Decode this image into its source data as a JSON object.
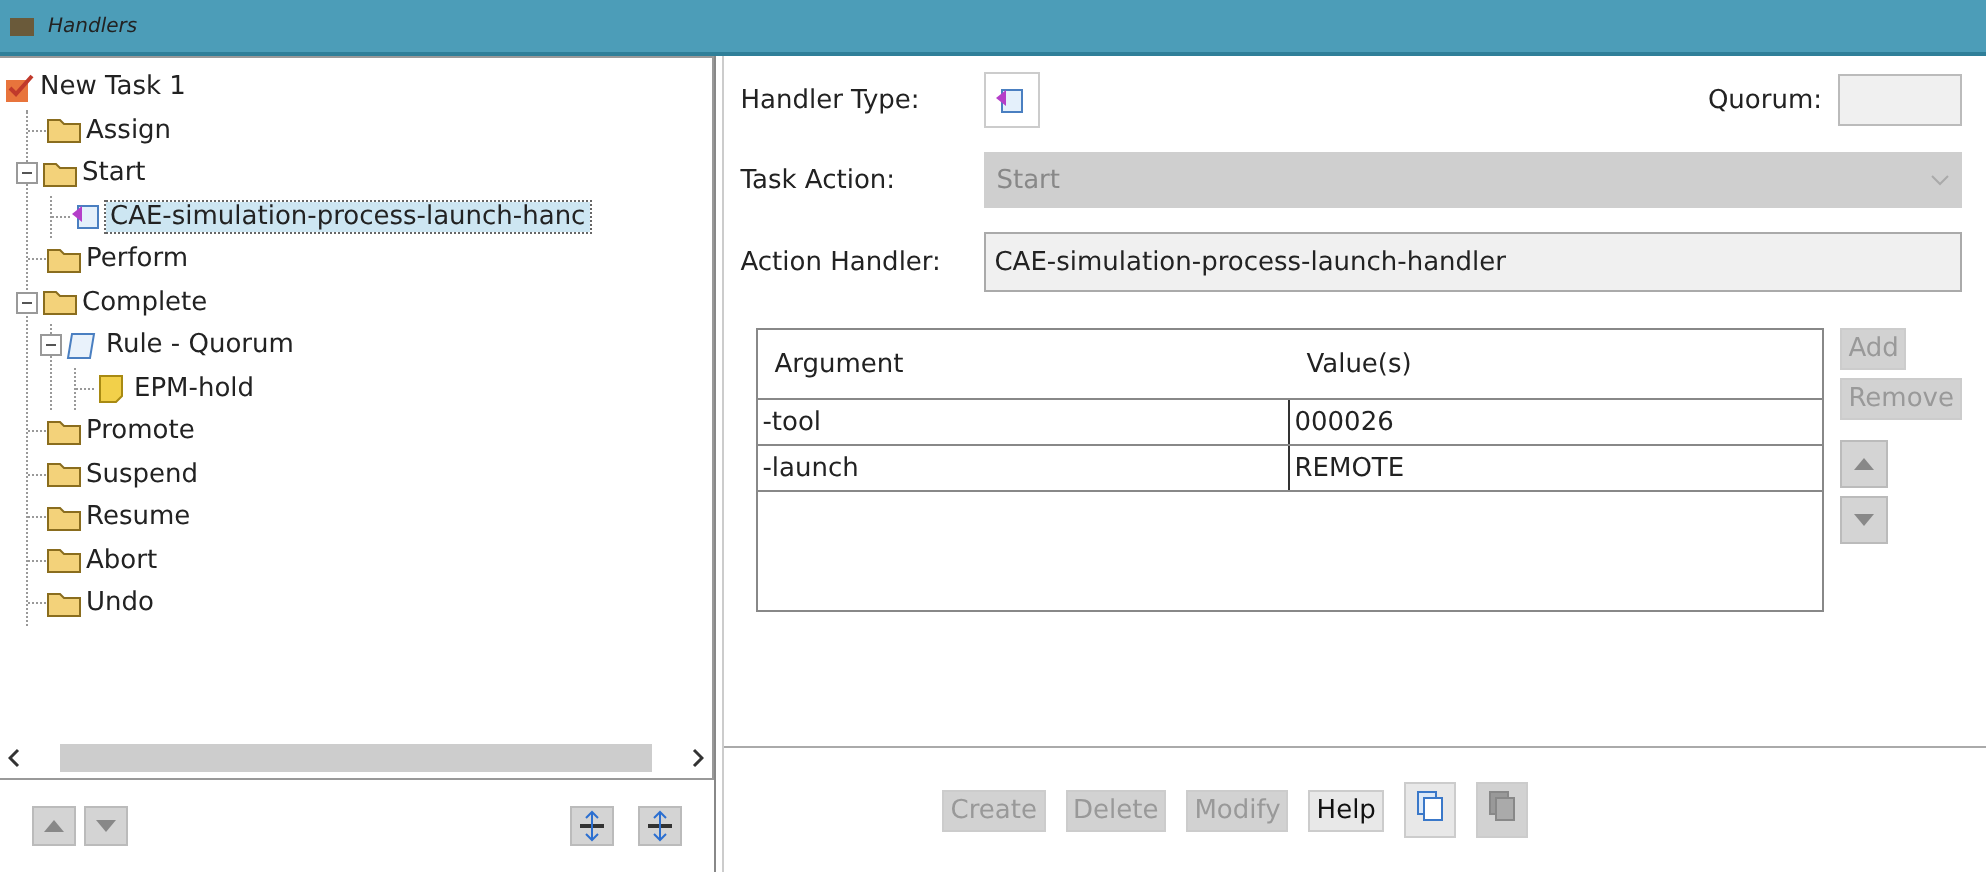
{
  "window": {
    "title": "Handlers"
  },
  "tree": [
    {
      "label": "New Task 1",
      "kind": "task",
      "selected": false,
      "children": [
        {
          "label": "Assign",
          "kind": "folder",
          "selected": false
        },
        {
          "label": "Start",
          "kind": "folder",
          "selected": false,
          "expanded": true,
          "children": [
            {
              "label": "CAE-simulation-process-launch-hanc",
              "kind": "handler",
              "selected": true
            }
          ]
        },
        {
          "label": "Perform",
          "kind": "folder",
          "selected": false
        },
        {
          "label": "Complete",
          "kind": "folder",
          "selected": false,
          "expanded": true,
          "children": [
            {
              "label": "Rule - Quorum",
              "kind": "rule",
              "selected": false,
              "expanded": true,
              "children": [
                {
                  "label": "EPM-hold",
                  "kind": "hold",
                  "selected": false
                }
              ]
            }
          ]
        },
        {
          "label": "Promote",
          "kind": "folder",
          "selected": false
        },
        {
          "label": "Suspend",
          "kind": "folder",
          "selected": false
        },
        {
          "label": "Resume",
          "kind": "folder",
          "selected": false
        },
        {
          "label": "Abort",
          "kind": "folder",
          "selected": false
        },
        {
          "label": "Undo",
          "kind": "folder",
          "selected": false
        }
      ]
    }
  ],
  "form": {
    "handler_type_label": "Handler Type:",
    "quorum_label": "Quorum:",
    "task_action_label": "Task Action:",
    "task_action": {
      "value": "Start",
      "disabled": true
    },
    "action_handler_label": "Action Handler:",
    "action_handler": "CAE-simulation-process-launch-handler"
  },
  "table": {
    "columns": [
      "Argument",
      "Value(s)"
    ],
    "rows": [
      [
        "-tool",
        "000026"
      ],
      [
        "-launch",
        "REMOTE"
      ]
    ]
  },
  "table_buttons": [
    {
      "label": "Add",
      "disabled": true
    },
    {
      "label": "Remove",
      "disabled": true
    }
  ],
  "bottom_buttons": [
    {
      "kind": "text",
      "label": "Create",
      "disabled": true
    },
    {
      "kind": "text",
      "label": "Delete",
      "disabled": true
    },
    {
      "kind": "text",
      "label": "Modify",
      "disabled": true
    },
    {
      "kind": "text",
      "label": "Help",
      "disabled": false
    },
    {
      "kind": "copy",
      "disabled": false
    },
    {
      "kind": "paste",
      "disabled": true
    }
  ]
}
